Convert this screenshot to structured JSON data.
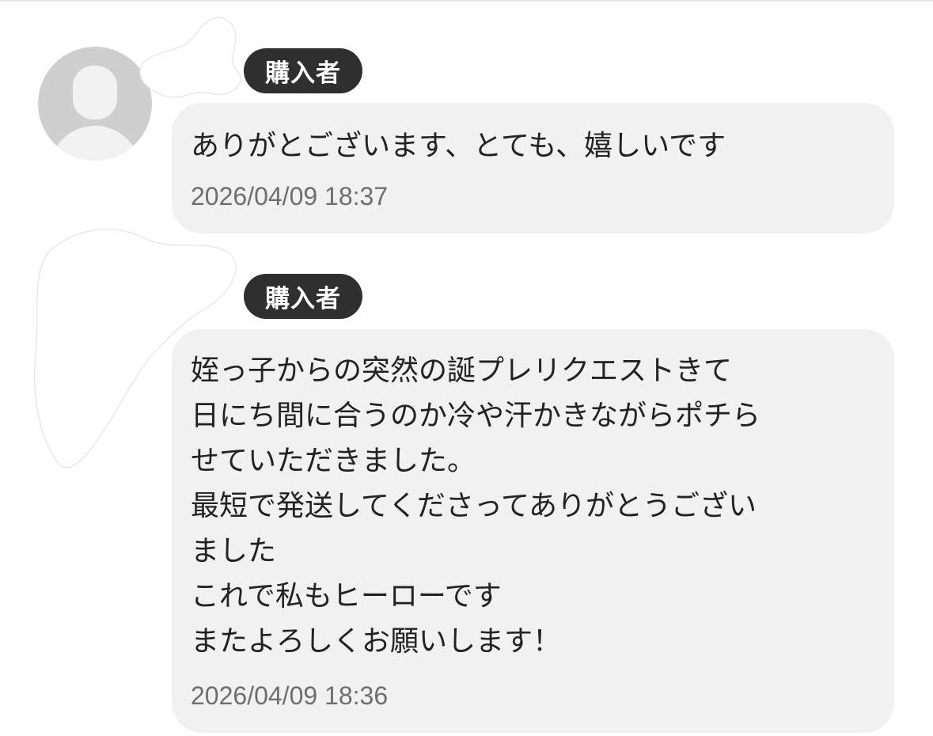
{
  "messages": [
    {
      "sender_badge": "購入者",
      "text": "ありがとございます、とても、嬉しいです",
      "timestamp": "2026/04/09 18:37"
    },
    {
      "sender_badge": "購入者",
      "text": "姪っ子からの突然の誕プレリクエストきて\n日にち間に合うのか冷や汗かきながらポチら\nせていただきました。\n最短で発送してくださってありがとうござい\nました\nこれで私もヒーローです\nまたよろしくお願いします！",
      "timestamp": "2026/04/09 18:36"
    }
  ],
  "colors": {
    "bubble_bg": "#f1f1f1",
    "badge_bg": "#2f2f2f",
    "avatar_bg": "#cfcfcf",
    "timestamp_text": "#6e6e6e"
  },
  "icons": {
    "avatar": "default-user-avatar-icon"
  }
}
